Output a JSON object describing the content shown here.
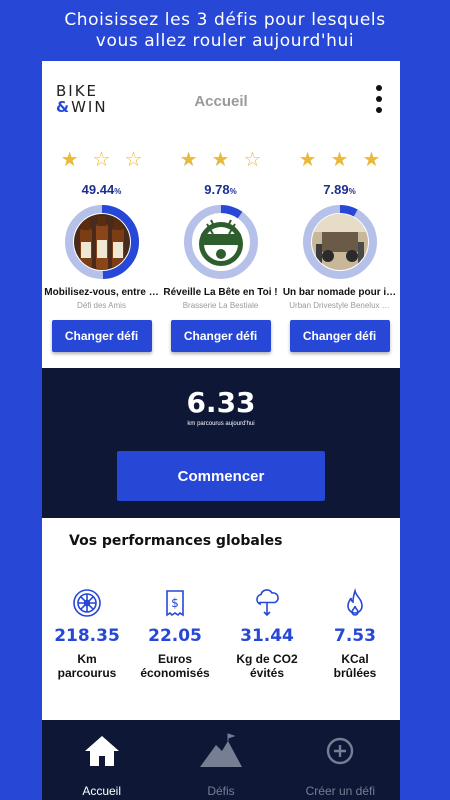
{
  "promo": {
    "line1": "Choisissez les 3 défis pour lesquels",
    "line2": "vous allez rouler aujourd'hui"
  },
  "header": {
    "logo_line1": "BIKE",
    "logo_line2_amp": "&",
    "logo_line2": "WIN",
    "title": "Accueil"
  },
  "challenges": [
    {
      "stars_filled": 1,
      "stars_total": 3,
      "percent": "49.44",
      "percent_unit": "%",
      "progress": 0.4944,
      "name": "Mobilisez-vous, entre …",
      "org": "Défi des Amis",
      "button": "Changer défi",
      "image": "beer-bottles"
    },
    {
      "stars_filled": 2,
      "stars_total": 3,
      "percent": "9.78",
      "percent_unit": "%",
      "progress": 0.0978,
      "name": "Réveille La Bête en Toi !",
      "org": "Brasserie La Bestiale",
      "button": "Changer défi",
      "image": "bestiale-logo"
    },
    {
      "stars_filled": 3,
      "stars_total": 3,
      "percent": "7.89",
      "percent_unit": "%",
      "progress": 0.0789,
      "name": "Un bar nomade pour i…",
      "org": "Urban Drivestyle Benelux …",
      "button": "Changer défi",
      "image": "nomad-bar"
    }
  ],
  "today": {
    "km": "6.33",
    "km_label": "km parcourus aujourd'hui",
    "start_button": "Commencer"
  },
  "performance": {
    "title": "Vos performances globales",
    "stats": [
      {
        "icon": "wheel-icon",
        "value": "218.35",
        "label_line1": "Km",
        "label_line2": "parcourus"
      },
      {
        "icon": "receipt-icon",
        "value": "22.05",
        "label_line1": "Euros",
        "label_line2": "économisés"
      },
      {
        "icon": "cloud-icon",
        "value": "31.44",
        "label_line1": "Kg de CO2",
        "label_line2": "évités"
      },
      {
        "icon": "flame-icon",
        "value": "7.53",
        "label_line1": "KCal",
        "label_line2": "brûlées"
      }
    ]
  },
  "tabs": [
    {
      "label": "Accueil",
      "icon": "home-icon",
      "active": true
    },
    {
      "label": "Défis",
      "icon": "mountain-icon",
      "active": false
    },
    {
      "label": "Créer un défi",
      "icon": "plus-circle-icon",
      "active": false
    }
  ],
  "colors": {
    "primary": "#2747d6",
    "dark": "#0e1836",
    "star": "#e8b93a",
    "ring_track": "#b6c1ea",
    "percent": "#1b2f8f"
  }
}
